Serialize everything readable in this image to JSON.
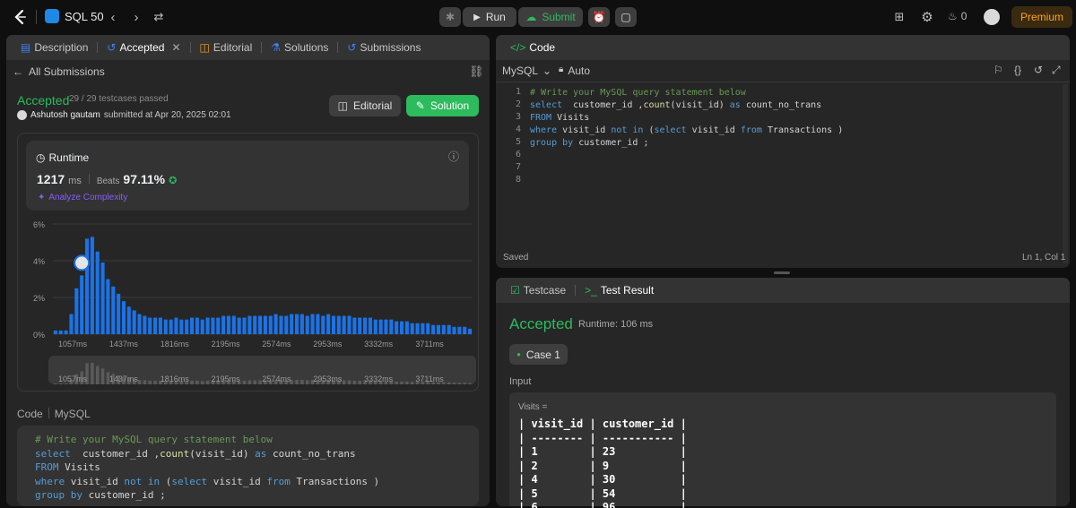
{
  "topbar": {
    "problem_list": "SQL 50",
    "run": "Run",
    "submit": "Submit",
    "streak": "0",
    "premium": "Premium"
  },
  "left_panel": {
    "tabs": [
      "Description",
      "Accepted",
      "Editorial",
      "Solutions",
      "Submissions"
    ],
    "back_label": "All Submissions",
    "status": "Accepted",
    "testcases": "29 / 29 testcases passed",
    "author": "Ashutosh gautam",
    "submitted_text": "submitted at Apr 20, 2025 02:01",
    "editorial_button": "Editorial",
    "solution_button": "Solution",
    "runtime_label": "Runtime",
    "runtime_value": "1217",
    "runtime_unit": "ms",
    "beats_label": "Beats",
    "beats_value": "97.11%",
    "analyze": "Analyze Complexity",
    "code_label": "Code",
    "code_lang": "MySQL"
  },
  "chart_data": {
    "type": "bar",
    "ylim": [
      0,
      6
    ],
    "yticks": [
      "6%",
      "4%",
      "2%",
      "0%"
    ],
    "xticks": [
      "1057ms",
      "1437ms",
      "1816ms",
      "2195ms",
      "2574ms",
      "2953ms",
      "3332ms",
      "3711ms"
    ],
    "values": [
      0.2,
      0.2,
      0.2,
      1.1,
      2.5,
      3.2,
      5.2,
      5.3,
      4.5,
      3.9,
      3.0,
      2.6,
      2.2,
      1.8,
      1.5,
      1.3,
      1.1,
      1.0,
      0.9,
      0.9,
      0.9,
      0.8,
      0.8,
      0.9,
      0.8,
      0.8,
      0.9,
      0.9,
      0.8,
      0.9,
      0.9,
      0.9,
      1.0,
      1.0,
      1.0,
      0.9,
      0.9,
      1.0,
      1.0,
      1.0,
      1.0,
      1.0,
      1.1,
      1.0,
      1.0,
      1.1,
      1.1,
      1.1,
      1.0,
      1.1,
      1.1,
      1.0,
      1.1,
      1.0,
      1.0,
      1.0,
      1.0,
      0.9,
      0.9,
      0.9,
      0.9,
      0.8,
      0.8,
      0.8,
      0.8,
      0.7,
      0.7,
      0.7,
      0.6,
      0.6,
      0.6,
      0.6,
      0.5,
      0.5,
      0.5,
      0.5,
      0.4,
      0.4,
      0.4,
      0.3
    ],
    "highlight_index": 5,
    "bar_color": "#1a73e8"
  },
  "code": {
    "language": "MySQL",
    "mode": "Auto",
    "header": "Code",
    "lines": [
      [
        {
          "t": "# Write your MySQL query statement below",
          "c": "cm"
        }
      ],
      [
        {
          "t": "select",
          "c": "kw"
        },
        {
          "t": "  customer_id ,",
          "c": "tx"
        },
        {
          "t": "count",
          "c": "fn"
        },
        {
          "t": "(visit_id) ",
          "c": "tx"
        },
        {
          "t": "as",
          "c": "kw"
        },
        {
          "t": " count_no_trans",
          "c": "tx"
        }
      ],
      [
        {
          "t": "FROM",
          "c": "kw"
        },
        {
          "t": " Visits",
          "c": "tx"
        }
      ],
      [
        {
          "t": "where",
          "c": "kw"
        },
        {
          "t": " visit_id ",
          "c": "tx"
        },
        {
          "t": "not in",
          "c": "kw"
        },
        {
          "t": " (",
          "c": "tx"
        },
        {
          "t": "select",
          "c": "kw"
        },
        {
          "t": " visit_id ",
          "c": "tx"
        },
        {
          "t": "from",
          "c": "kw"
        },
        {
          "t": " Transactions )",
          "c": "tx"
        }
      ],
      [
        {
          "t": "group by",
          "c": "kw"
        },
        {
          "t": " customer_id ;",
          "c": "tx"
        }
      ],
      [],
      [],
      []
    ],
    "saved": "Saved",
    "cursor": "Ln 1, Col 1"
  },
  "result": {
    "tabs": [
      "Testcase",
      "Test Result"
    ],
    "status": "Accepted",
    "runtime": "Runtime: 106 ms",
    "case": "Case 1",
    "input_label": "Input",
    "table_name": "Visits =",
    "table_lines": [
      "| visit_id | customer_id |",
      "| -------- | ----------- |",
      "| 1        | 23          |",
      "| 2        | 9           |",
      "| 4        | 30          |",
      "| 5        | 54          |",
      "| 6        | 96          |"
    ]
  }
}
